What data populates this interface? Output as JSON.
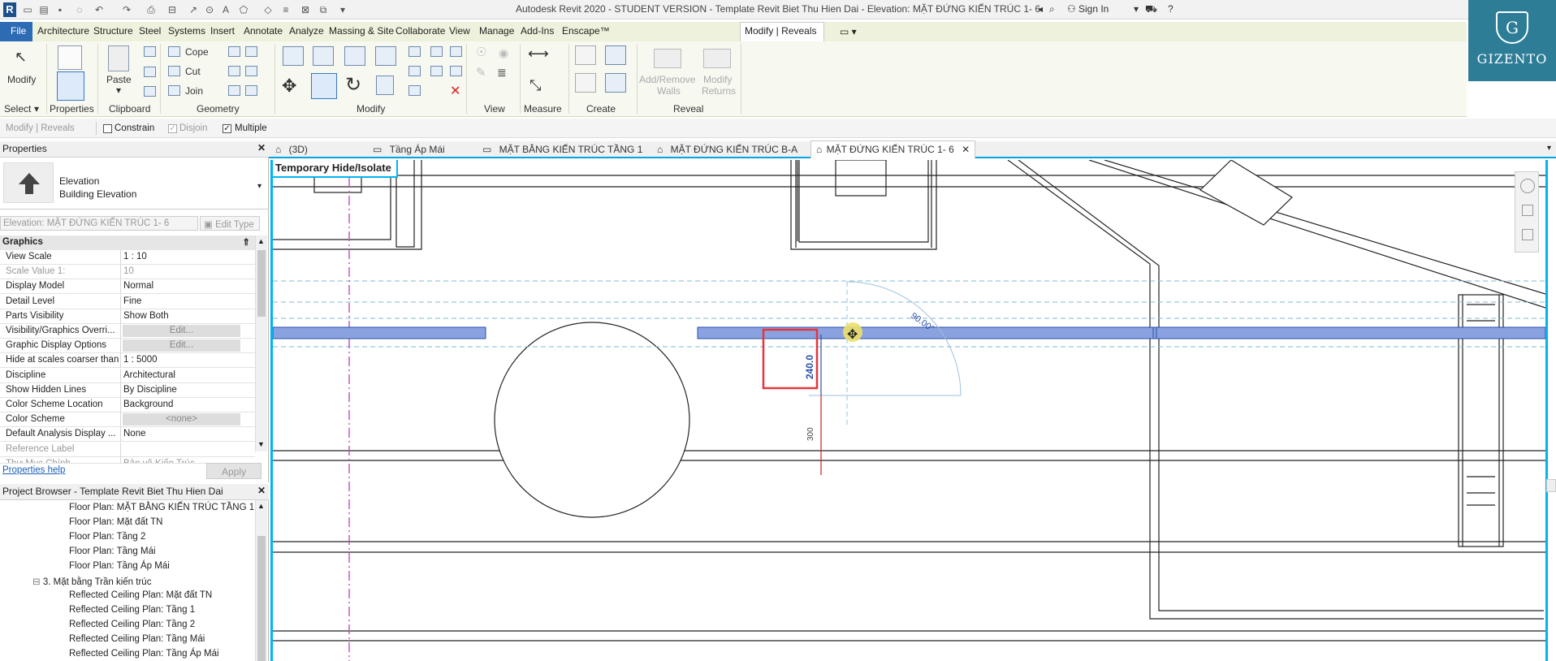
{
  "window": {
    "title": "Autodesk Revit 2020 - STUDENT VERSION - Template Revit Biet Thu Hien Dai - Elevation: MẶT ĐỨNG KIẾN TRÚC 1- 6",
    "sign_in": "Sign In"
  },
  "menu": {
    "file": "File",
    "items": [
      "Architecture",
      "Structure",
      "Steel",
      "Systems",
      "Insert",
      "Annotate",
      "Analyze",
      "Massing & Site",
      "Collaborate",
      "View",
      "Manage",
      "Add-Ins",
      "Enscape™",
      "Modify | Reveals"
    ]
  },
  "ribbon": {
    "modify": "Modify",
    "select": "Select",
    "properties": "Properties",
    "paste": "Paste",
    "clipboard": "Clipboard",
    "cope": "Cope",
    "cut": "Cut",
    "join": "Join",
    "geometry": "Geometry",
    "modify_panel": "Modify",
    "view": "View",
    "measure": "Measure",
    "create": "Create",
    "add_remove_walls": "Add/Remove",
    "add_remove_walls2": "Walls",
    "modify_returns": "Modify",
    "modify_returns2": "Returns",
    "reveal": "Reveal"
  },
  "context_bar": {
    "label": "Modify | Reveals",
    "constrain": "Constrain",
    "disjoin": "Disjoin",
    "multiple": "Multiple"
  },
  "logo": {
    "text": "GIZENTO",
    "glyph": "G"
  },
  "properties": {
    "title": "Properties",
    "type_name": "Elevation",
    "type_sub": "Building Elevation",
    "selector": "Elevation: MẶT ĐỨNG KIẾN TRÚC 1- 6",
    "edit_type": "Edit Type",
    "section": "Graphics",
    "rows": [
      {
        "name": "View Scale",
        "value": "1 : 10"
      },
      {
        "name": "Scale Value    1:",
        "value": "10"
      },
      {
        "name": "Display Model",
        "value": "Normal"
      },
      {
        "name": "Detail Level",
        "value": "Fine"
      },
      {
        "name": "Parts Visibility",
        "value": "Show Both"
      },
      {
        "name": "Visibility/Graphics Overri...",
        "value": "Edit..."
      },
      {
        "name": "Graphic Display Options",
        "value": "Edit..."
      },
      {
        "name": "Hide at scales coarser than",
        "value": "1 : 5000"
      },
      {
        "name": "Discipline",
        "value": "Architectural"
      },
      {
        "name": "Show Hidden Lines",
        "value": "By Discipline"
      },
      {
        "name": "Color Scheme Location",
        "value": "Background"
      },
      {
        "name": "Color Scheme",
        "value": "<none>"
      },
      {
        "name": "Default Analysis Display ...",
        "value": "None"
      },
      {
        "name": "Reference Label",
        "value": ""
      },
      {
        "name": "Thư Mục Chính",
        "value": "Bản vẽ Kiến Trúc"
      }
    ],
    "help": "Properties help",
    "apply": "Apply"
  },
  "browser": {
    "title": "Project Browser - Template Revit Biet Thu Hien Dai",
    "items": [
      "Floor Plan: MẶT BẰNG KIẾN TRÚC TẦNG 1",
      "Floor Plan: Mặt đất TN",
      "Floor Plan: Tầng 2",
      "Floor Plan: Tầng Mái",
      "Floor Plan: Tầng Áp Mái",
      "3. Mặt bằng Trần kiến trúc",
      "Reflected Ceiling Plan: Mặt đất TN",
      "Reflected Ceiling Plan: Tầng 1",
      "Reflected Ceiling Plan: Tầng 2",
      "Reflected Ceiling Plan: Tầng Mái",
      "Reflected Ceiling Plan: Tầng Áp Mái"
    ]
  },
  "view_tabs": [
    "(3D)",
    "Tầng Áp Mái",
    "MẶT BẰNG KIẾN TRÚC TẦNG 1",
    "MẶT ĐỨNG KIẾN TRÚC B-A",
    "MẶT ĐỨNG KIẾN TRÚC 1- 6"
  ],
  "canvas": {
    "temp_label": "Temporary Hide/Isolate",
    "dim_vertical": "240.0",
    "dim_small": "300",
    "dim_angle": "90.00°"
  },
  "colors": {
    "accent": "#00b4f0",
    "reveal_band": "#8aa2df",
    "highlight": "#e5363a"
  }
}
